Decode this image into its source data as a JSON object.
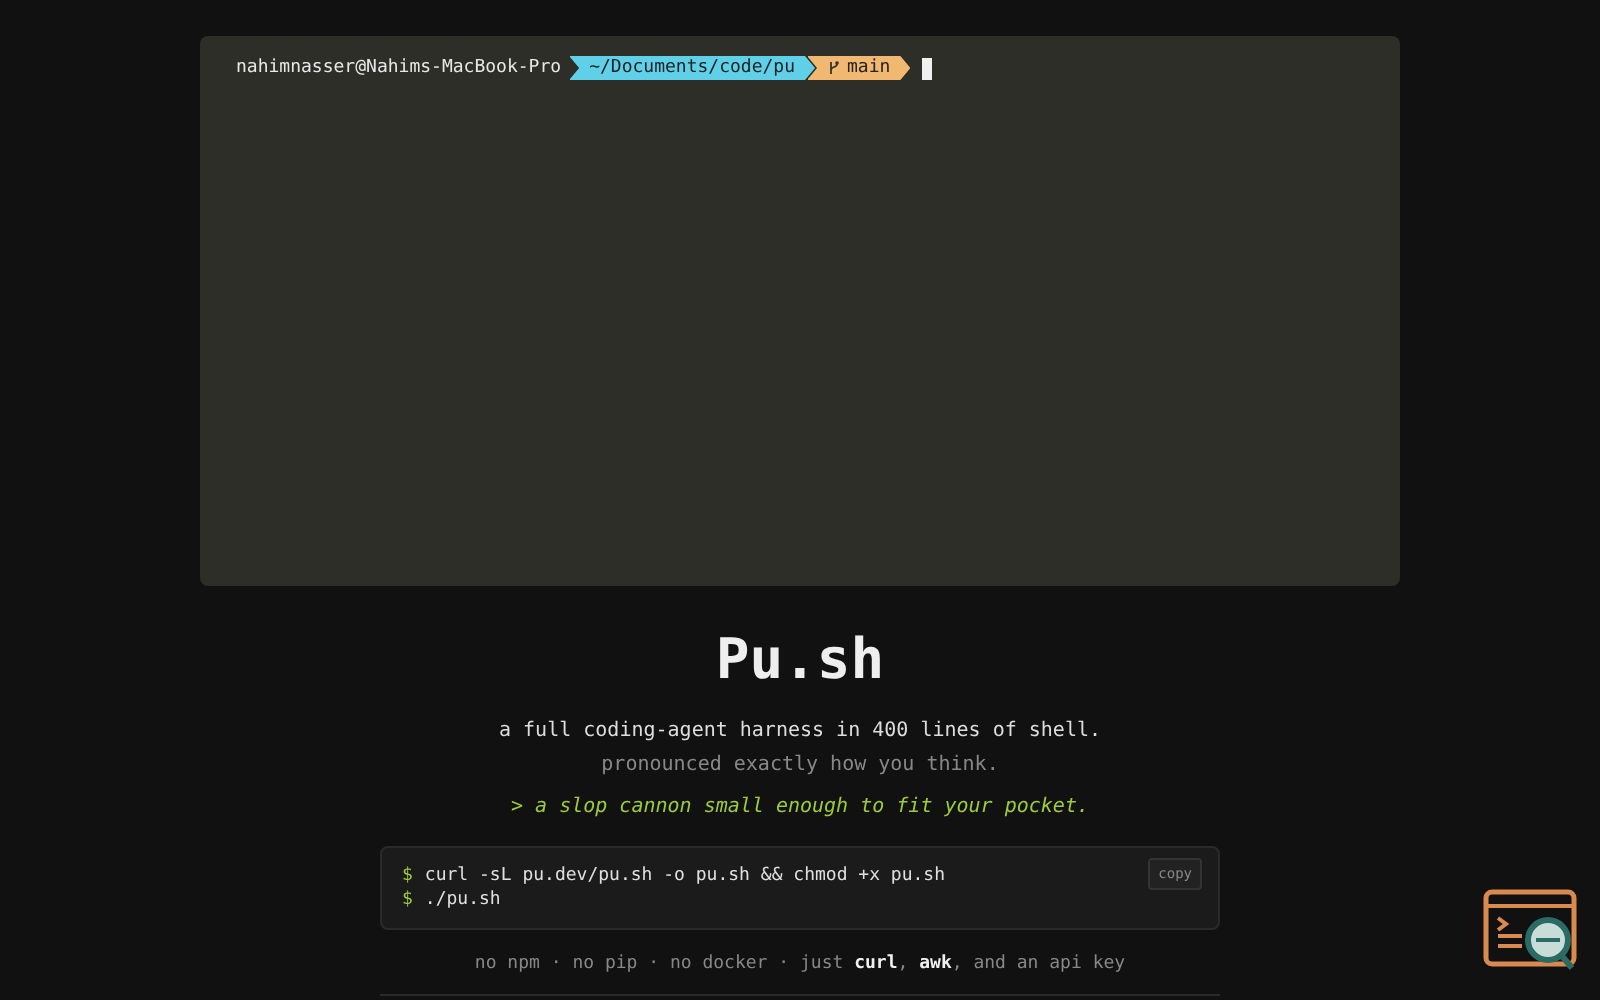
{
  "terminal": {
    "prompt": {
      "user": "nahimnasser@Nahims-MacBook-Pro",
      "path": "~/Documents/code/pu",
      "branch": "main"
    }
  },
  "hero": {
    "title": "Pu.sh",
    "tagline": "a full coding-agent harness in 400 lines of shell.",
    "subtitle": "pronounced exactly how you think.",
    "motto": "> a slop cannon small enough to fit your pocket."
  },
  "install": {
    "copy_label": "copy",
    "lines": [
      {
        "prompt": "$",
        "command": "curl -sL pu.dev/pu.sh -o pu.sh && chmod +x pu.sh"
      },
      {
        "prompt": "$",
        "command": "./pu.sh"
      }
    ]
  },
  "footer": {
    "note": "no npm · no pip · no docker · just **curl**, **awk**, and an api key"
  }
}
